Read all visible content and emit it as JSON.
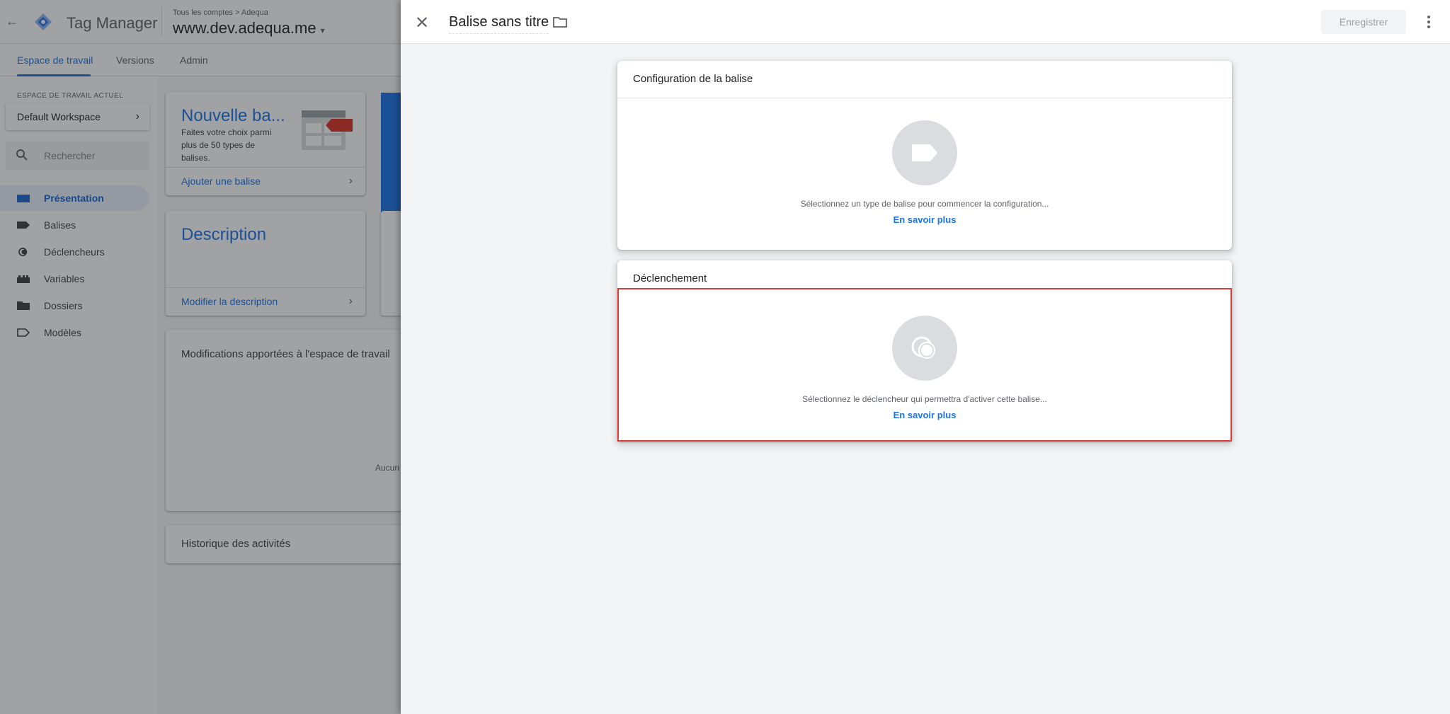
{
  "background": {
    "app_title": "Tag Manager",
    "breadcrumb": "Tous les comptes > Adequa",
    "container": "www.dev.adequa.me",
    "tabs": [
      {
        "label": "Espace de travail",
        "active": true
      },
      {
        "label": "Versions",
        "active": false
      },
      {
        "label": "Admin",
        "active": false
      }
    ],
    "sidebar": {
      "workspace_section_label": "ESPACE DE TRAVAIL ACTUEL",
      "workspace_name": "Default Workspace",
      "search_placeholder": "Rechercher",
      "items": [
        {
          "label": "Présentation",
          "icon": "briefcase-icon",
          "active": true
        },
        {
          "label": "Balises",
          "icon": "tag-icon",
          "active": false
        },
        {
          "label": "Déclencheurs",
          "icon": "trigger-icon",
          "active": false
        },
        {
          "label": "Variables",
          "icon": "variables-icon",
          "active": false
        },
        {
          "label": "Dossiers",
          "icon": "folder-icon",
          "active": false
        },
        {
          "label": "Modèles",
          "icon": "template-icon",
          "active": false
        }
      ]
    },
    "cards": {
      "new_tag_title": "Nouvelle ba...",
      "new_tag_desc_lines": [
        "Faites votre choix parmi",
        "plus de 50 types de",
        "balises."
      ],
      "new_tag_link": "Ajouter une balise",
      "description_title": "Description",
      "description_link": "Modifier la description",
      "changes_title": "Modifications apportées à l'espace de travail",
      "changes_stub": "Aucun",
      "history_title": "Historique des activités"
    }
  },
  "panel": {
    "tag_name": "Balise sans titre",
    "save_label": "Enregistrer",
    "config_section": {
      "title": "Configuration de la balise",
      "empty_text": "Sélectionnez un type de balise pour commencer la configuration...",
      "link": "En savoir plus"
    },
    "trigger_section": {
      "title": "Déclenchement",
      "empty_text": "Sélectionnez le déclencheur qui permettra d'activer cette balise...",
      "link": "En savoir plus"
    }
  },
  "colors": {
    "accent": "#1a73e8",
    "highlight_border": "#e53935",
    "panel_bg": "#f1f3f4"
  }
}
